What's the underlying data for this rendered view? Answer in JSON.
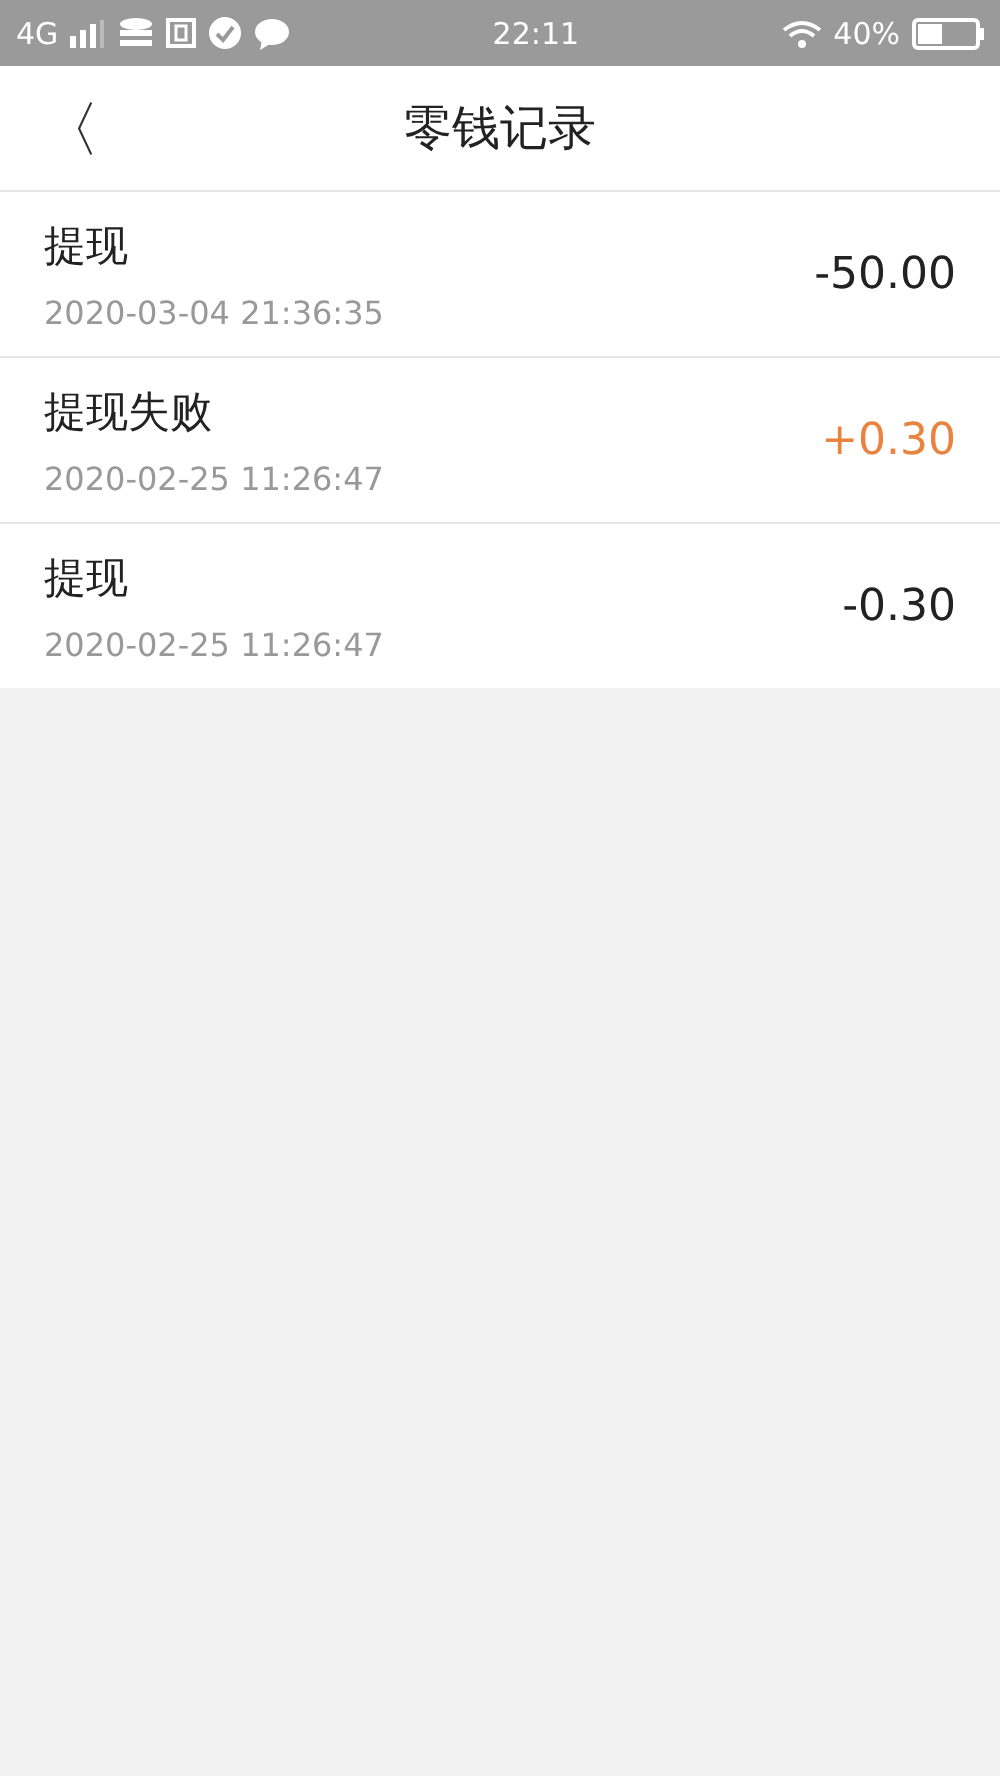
{
  "status_bar": {
    "network": "4G",
    "time": "22:11",
    "battery": "40%"
  },
  "header": {
    "back": "〈",
    "title": "零钱记录"
  },
  "records": [
    {
      "title": "提现",
      "time": "2020-03-04 21:36:35",
      "amount": "-50.00",
      "kind": "expense"
    },
    {
      "title": "提现失败",
      "time": "2020-02-25 11:26:47",
      "amount": "+0.30",
      "kind": "income"
    },
    {
      "title": "提现",
      "time": "2020-02-25 11:26:47",
      "amount": "-0.30",
      "kind": "expense"
    }
  ]
}
